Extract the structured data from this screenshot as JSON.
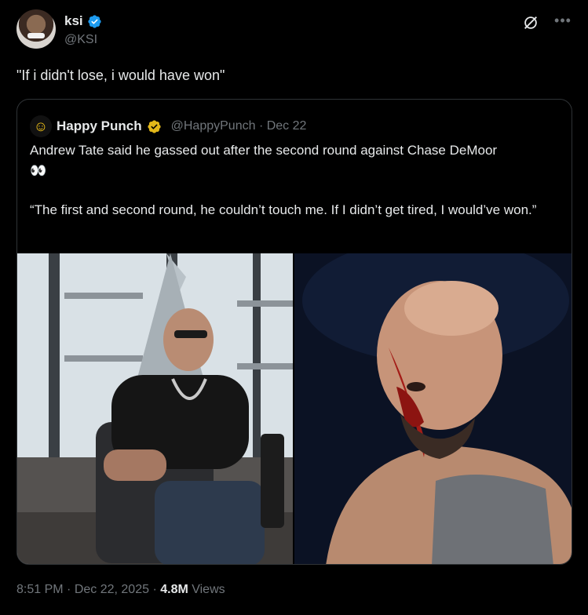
{
  "author": {
    "name": "ksi",
    "handle": "@KSI"
  },
  "tweet_text": "\"If i didn't lose, i would have won\"",
  "quote": {
    "name": "Happy Punch",
    "handle": "@HappyPunch",
    "separator": "·",
    "date": "Dec 22",
    "avatar_glyph": "☺",
    "line1": "Andrew Tate said he gassed out after the second round against Chase DeMoor",
    "emoji": "👀",
    "line2": "“The first and second round, he couldn’t touch me. If I didn’t get tired, I would’ve won.”"
  },
  "footer": {
    "time": "8:51 PM",
    "sep1": " · ",
    "date": "Dec 22, 2025",
    "sep2": " · ",
    "views_count": "4.8M",
    "views_label": " Views"
  },
  "icons": {
    "verified": "verified-badge-icon",
    "grok": "grok-icon",
    "more": "more-icon",
    "quote_badge": "gold-verified-badge-icon"
  },
  "colors": {
    "background": "#000000",
    "text": "#e7e9ea",
    "secondary": "#71767b",
    "verified_blue": "#1d9bf0",
    "verified_gold": "#e2b719",
    "border": "#2f3336"
  }
}
